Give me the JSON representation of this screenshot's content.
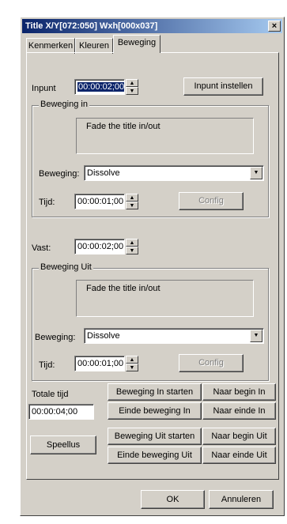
{
  "window": {
    "title": "Title  X/Y[072:050] Wxh[000x037]",
    "close_glyph": "×"
  },
  "tabs": [
    {
      "label": "Kenmerken"
    },
    {
      "label": "Kleuren"
    },
    {
      "label": "Beweging"
    }
  ],
  "inpunt": {
    "label": "Inpunt",
    "value": "00:00:02;00",
    "button": "Inpunt instellen"
  },
  "beweging_in": {
    "title": "Beweging in",
    "description": "Fade the title in/out",
    "beweging_label": "Beweging:",
    "beweging_value": "Dissolve",
    "tijd_label": "Tijd:",
    "tijd_value": "00:00:01;00",
    "config": "Config"
  },
  "vast": {
    "label": "Vast:",
    "value": "00:00:02;00"
  },
  "beweging_uit": {
    "title": "Beweging Uit",
    "description": "Fade the title in/out",
    "beweging_label": "Beweging:",
    "beweging_value": "Dissolve",
    "tijd_label": "Tijd:",
    "tijd_value": "00:00:01;00",
    "config": "Config"
  },
  "totale_tijd": {
    "label": "Totale tijd",
    "value": "00:00:04;00"
  },
  "buttons": {
    "beweging_in_starten": "Beweging In starten",
    "naar_begin_in": "Naar begin In",
    "einde_beweging_in": "Einde beweging In",
    "naar_einde_in": "Naar einde In",
    "beweging_uit_starten": "Beweging Uit starten",
    "naar_begin_uit": "Naar begin Uit",
    "einde_beweging_uit": "Einde beweging Uit",
    "naar_einde_uit": "Naar einde Uit",
    "speellus": "Speellus",
    "ok": "OK",
    "annuleren": "Annuleren"
  },
  "icons": {
    "spin_up": "▲",
    "spin_down": "▼",
    "dropdown": "▼"
  }
}
